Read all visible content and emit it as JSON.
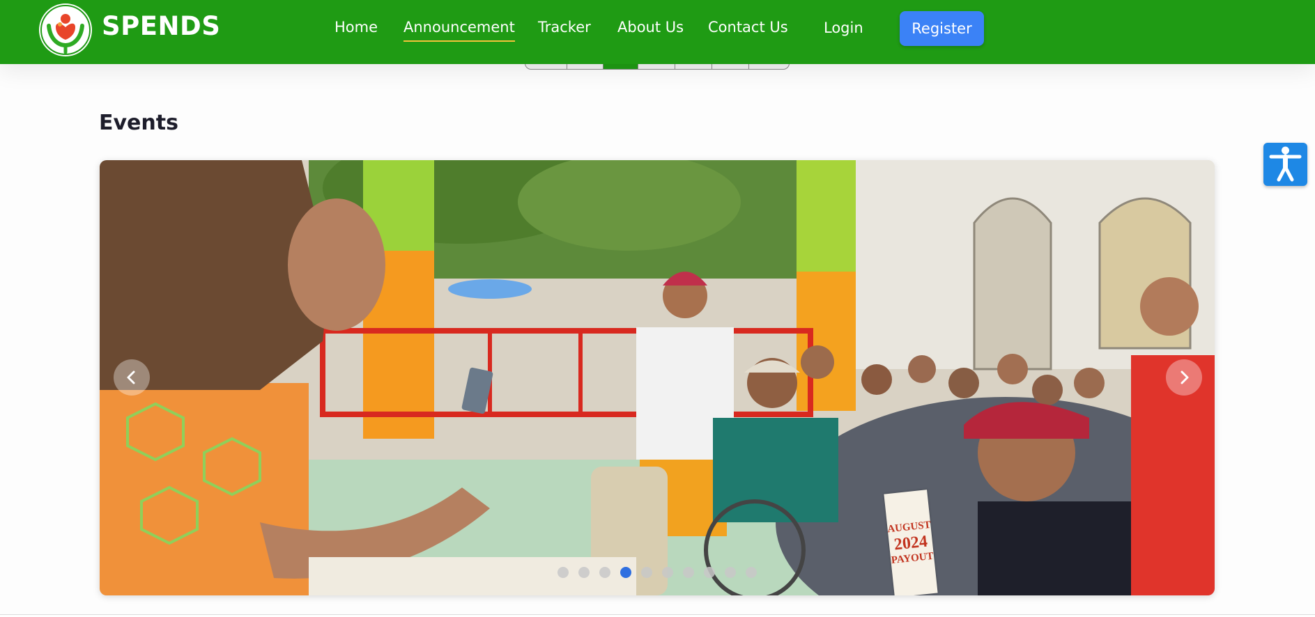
{
  "navbar": {
    "brand": "SPENDS",
    "links": [
      {
        "label": "Home"
      },
      {
        "label": "Announcement",
        "active": true
      },
      {
        "label": "Tracker"
      },
      {
        "label": "About Us"
      },
      {
        "label": "Contact Us"
      },
      {
        "label": "Login"
      }
    ],
    "register_label": "Register"
  },
  "pager": {
    "segments": 7,
    "active_index": 2
  },
  "events": {
    "title": "Events",
    "carousel": {
      "slide_count": 10,
      "active_index": 3,
      "sign_text": [
        "AUGUST",
        "2024",
        "PAYOUT"
      ]
    }
  },
  "colors": {
    "nav_green": "#1f9b14",
    "register_blue": "#3b82f6",
    "active_underline": "#f5c23a",
    "indicator_active": "#2f6fe0",
    "a11y_blue": "#1e88e5"
  },
  "icons": {
    "logo": "spends-logo-icon",
    "prev": "chevron-left-icon",
    "next": "chevron-right-icon",
    "accessibility": "accessibility-icon"
  }
}
